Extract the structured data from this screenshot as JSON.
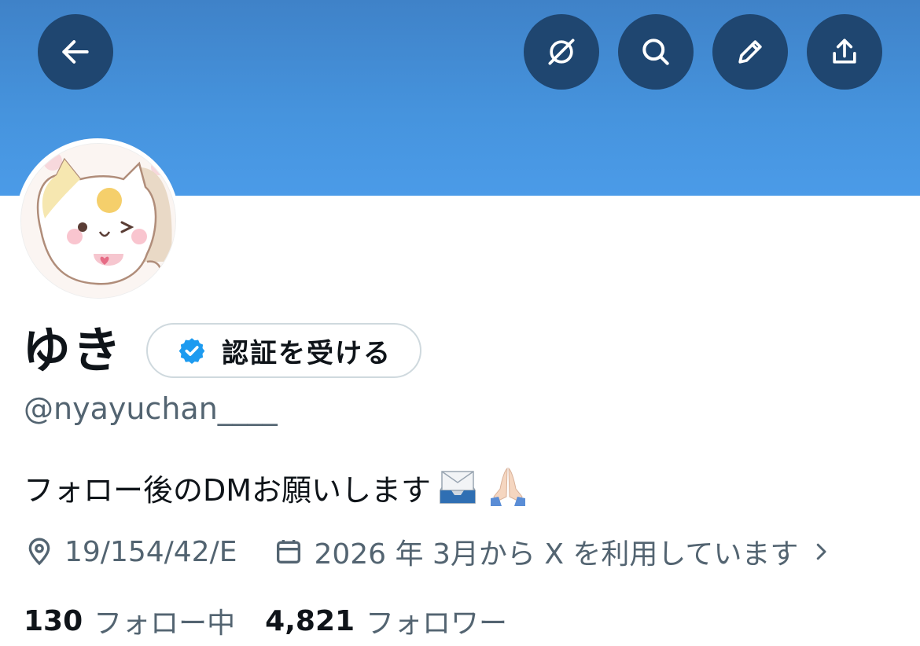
{
  "profile": {
    "display_name": "ゆき",
    "verify_button_label": "認証を受ける",
    "handle": "@nyayuchan____",
    "bio": "フォロー後のDMお願いします",
    "location": "19/154/42/E",
    "joined": "2026 年 3月から X を利用しています",
    "following_count": "130",
    "following_label": "フォロー中",
    "followers_count": "4,821",
    "followers_label": "フォロワー"
  },
  "header": {
    "icons": [
      "back-arrow-icon",
      "grok-icon",
      "search-icon",
      "edit-pencil-icon",
      "share-upload-icon"
    ]
  },
  "colors": {
    "banner": "#4694de",
    "header_button": "#1f4670",
    "verified_blue": "#1d9bf0",
    "secondary_text": "#536471"
  }
}
